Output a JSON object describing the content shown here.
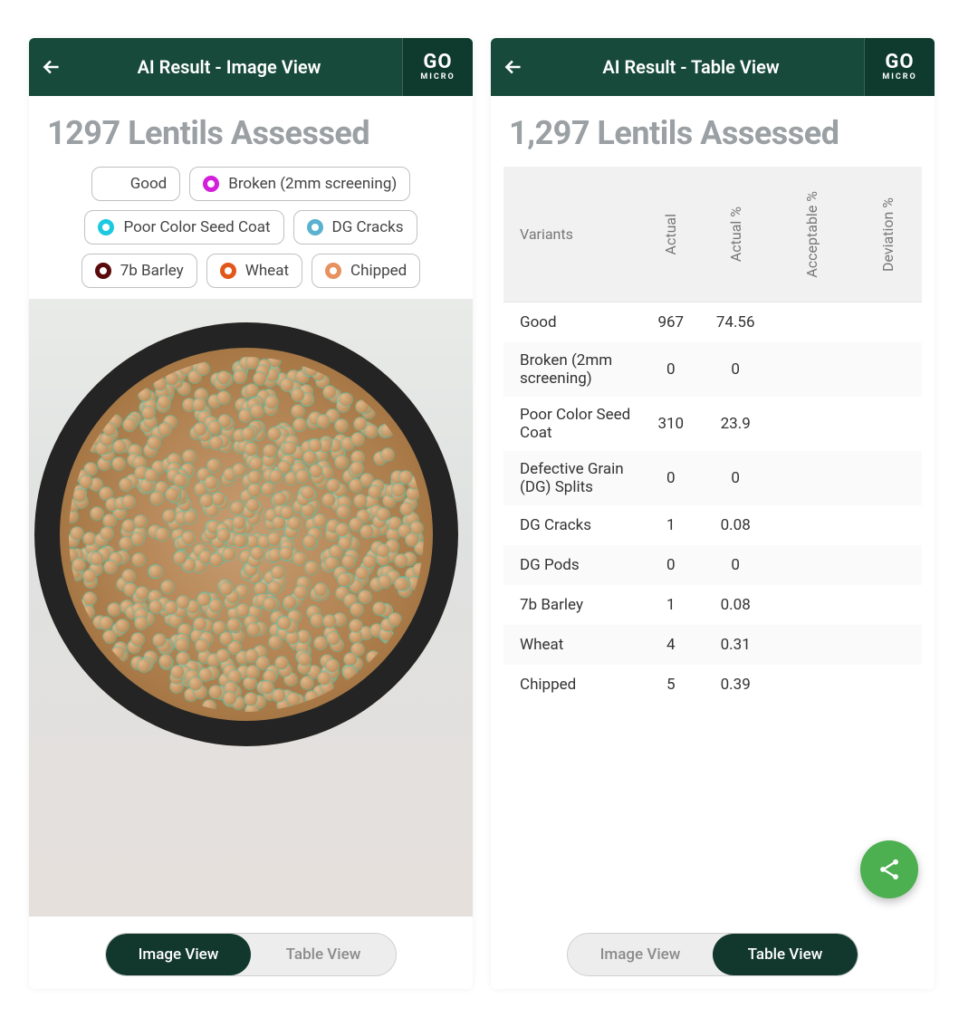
{
  "brand": {
    "go": "GO",
    "micro": "MICRO"
  },
  "left": {
    "header_title": "AI Result - Image View",
    "main_title": "1297 Lentils Assessed",
    "chips": [
      {
        "label": "Good",
        "color": "#ffffff"
      },
      {
        "label": "Broken (2mm screening)",
        "color": "#d41edc"
      },
      {
        "label": "Poor Color Seed Coat",
        "color": "#1cc9e1"
      },
      {
        "label": "DG Cracks",
        "color": "#5ab2cf"
      },
      {
        "label": "7b Barley",
        "color": "#5a0a0a"
      },
      {
        "label": "Wheat",
        "color": "#e0591b"
      },
      {
        "label": "Chipped",
        "color": "#e7915e"
      }
    ],
    "toggle": {
      "image": "Image View",
      "table": "Table View",
      "active": "image"
    }
  },
  "right": {
    "header_title": "AI Result - Table View",
    "main_title": "1,297 Lentils Assessed",
    "table": {
      "headers": [
        "Variants",
        "Actual",
        "Actual %",
        "Acceptable %",
        "Deviation %"
      ],
      "rows": [
        {
          "variant": "Good",
          "actual": "967",
          "actual_pct": "74.56",
          "acceptable": "",
          "deviation": ""
        },
        {
          "variant": "Broken (2mm screening)",
          "actual": "0",
          "actual_pct": "0",
          "acceptable": "",
          "deviation": ""
        },
        {
          "variant": "Poor Color Seed Coat",
          "actual": "310",
          "actual_pct": "23.9",
          "acceptable": "",
          "deviation": ""
        },
        {
          "variant": "Defective Grain (DG) Splits",
          "actual": "0",
          "actual_pct": "0",
          "acceptable": "",
          "deviation": ""
        },
        {
          "variant": "DG Cracks",
          "actual": "1",
          "actual_pct": "0.08",
          "acceptable": "",
          "deviation": ""
        },
        {
          "variant": "DG Pods",
          "actual": "0",
          "actual_pct": "0",
          "acceptable": "",
          "deviation": ""
        },
        {
          "variant": "7b Barley",
          "actual": "1",
          "actual_pct": "0.08",
          "acceptable": "",
          "deviation": ""
        },
        {
          "variant": "Wheat",
          "actual": "4",
          "actual_pct": "0.31",
          "acceptable": "",
          "deviation": ""
        },
        {
          "variant": "Chipped",
          "actual": "5",
          "actual_pct": "0.39",
          "acceptable": "",
          "deviation": ""
        }
      ]
    },
    "toggle": {
      "image": "Image View",
      "table": "Table View",
      "active": "table"
    }
  }
}
